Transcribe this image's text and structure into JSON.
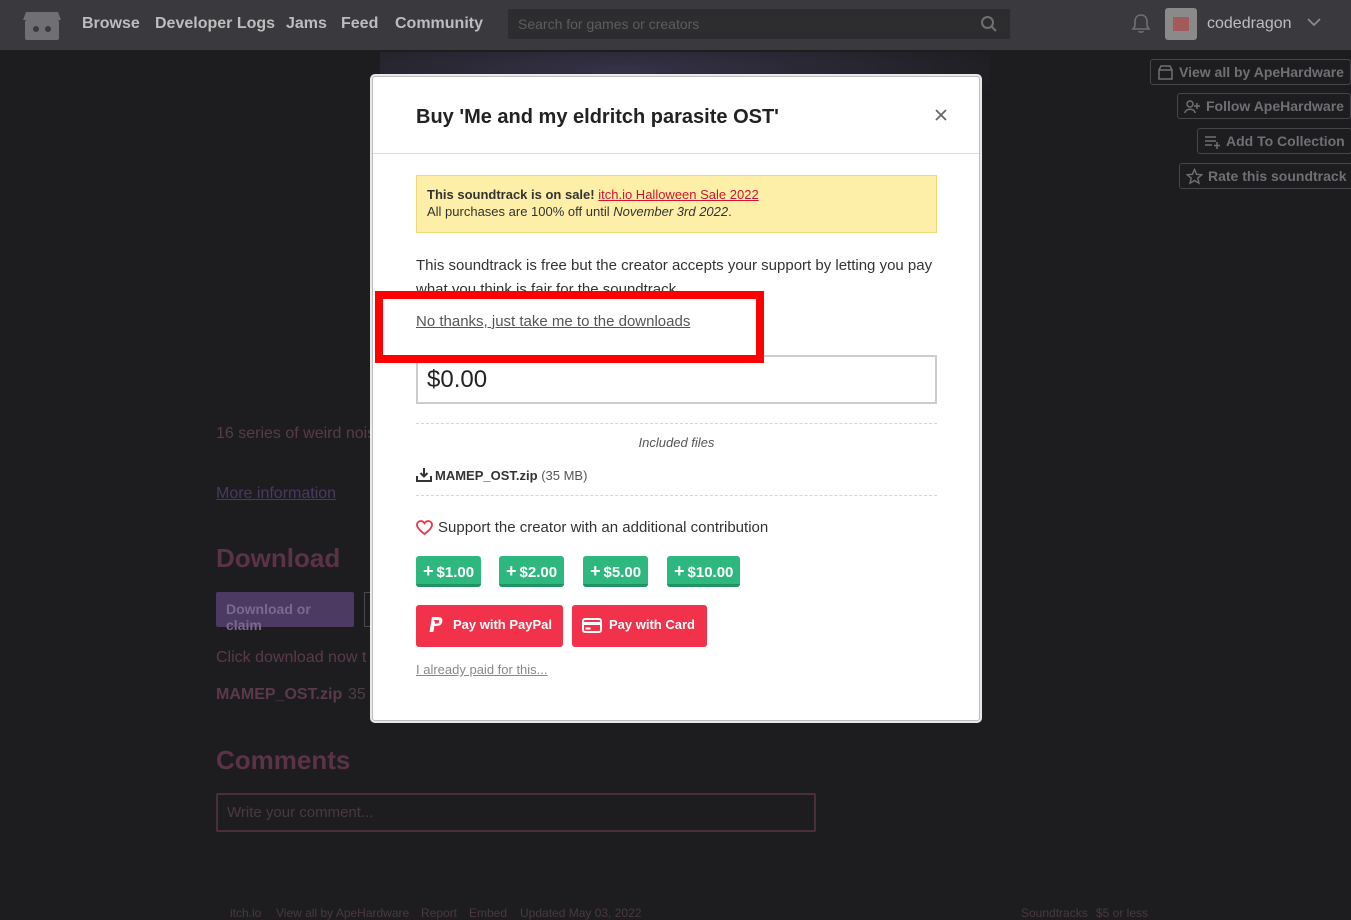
{
  "header": {
    "nav": [
      "Browse",
      "Developer Logs",
      "Jams",
      "Feed",
      "Community"
    ],
    "search_placeholder": "Search for games or creators",
    "username": "codedragon"
  },
  "sidebar_actions": [
    "View all by ApeHardware",
    "Follow ApeHardware",
    "Add To Collection",
    "Rate this soundtrack"
  ],
  "background": {
    "description": "16 series of weird nois",
    "more_info": "More information",
    "download_heading": "Download",
    "download_button": "Download or claim",
    "download_hint": "Click download now t",
    "file_name": "MAMEP_OST.zip",
    "file_size_partial": "35",
    "comments_heading": "Comments",
    "comment_placeholder": "Write your comment...",
    "footer_left": [
      "itch.io",
      "View all by ApeHardware",
      "Report",
      "Embed",
      "Updated May 03, 2022"
    ],
    "footer_right": [
      "Soundtracks",
      "$5 or less"
    ]
  },
  "modal": {
    "title": "Buy 'Me and my eldritch parasite OST'",
    "sale": {
      "prefix": "This soundtrack is on sale!",
      "link": "itch.io Halloween Sale 2022",
      "line2_prefix": "All purchases are 100% off until",
      "line2_date": "November 3rd 2022",
      "line2_suffix": "."
    },
    "description": "This soundtrack is free but the creator accepts your support by letting you pay what you think is fair for the soundtrack.",
    "no_thanks": "No thanks, just take me to the downloads",
    "price_value": "$0.00",
    "included_label": "Included files",
    "file": {
      "name": "MAMEP_OST.zip",
      "size": "(35 MB)"
    },
    "support_text": "Support the creator with an additional contribution",
    "tips": [
      "$1.00",
      "$2.00",
      "$5.00",
      "$10.00"
    ],
    "pay_paypal": "Pay with PayPal",
    "pay_card": "Pay with Card",
    "already_paid": "I already paid for this..."
  },
  "colors": {
    "accent_red": "#f2314a",
    "tip_green": "#2eb87f",
    "sale_bg": "#fdefa8",
    "highlight": "#ff0000"
  }
}
